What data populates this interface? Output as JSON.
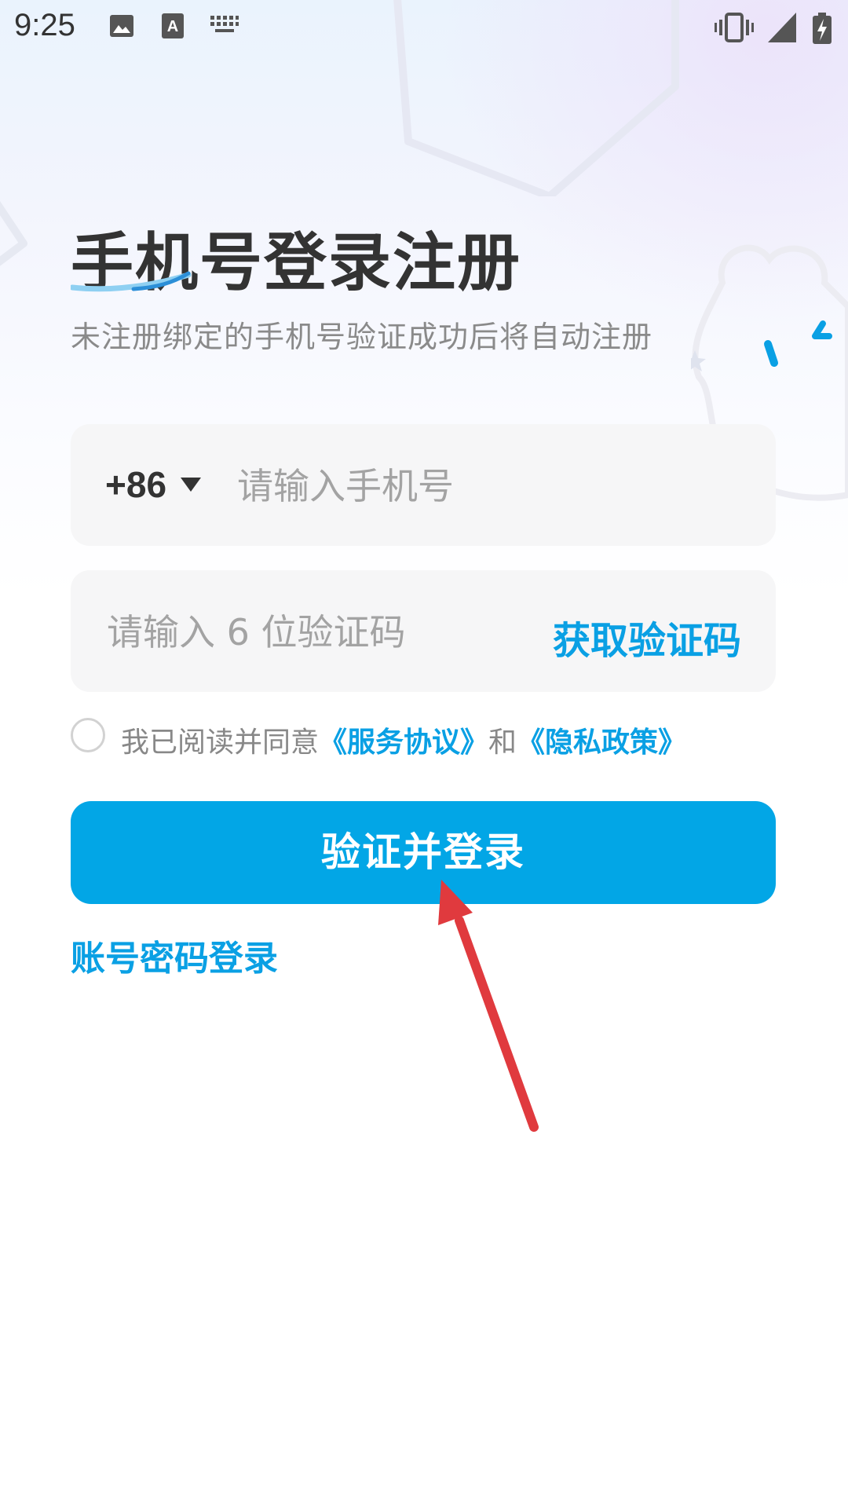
{
  "status_bar": {
    "time": "9:25",
    "icons": [
      "image-icon",
      "text-a-icon",
      "keyboard-icon",
      "vibrate-icon",
      "signal-icon",
      "battery-charging-icon"
    ]
  },
  "header": {
    "title": "手机号登录注册",
    "subtitle": "未注册绑定的手机号验证成功后将自动注册"
  },
  "phone_field": {
    "country_code": "+86",
    "placeholder": "请输入手机号",
    "value": ""
  },
  "code_field": {
    "placeholder": "请输入 6 位验证码",
    "value": "",
    "get_code_label": "获取验证码"
  },
  "agreement": {
    "checked": false,
    "prefix": "我已阅读并同意",
    "service_link": "《服务协议》",
    "conjunction": "和",
    "privacy_link": "《隐私政策》"
  },
  "actions": {
    "submit_label": "验证并登录",
    "alt_login_label": "账号密码登录"
  },
  "colors": {
    "accent": "#02a6e6",
    "link": "#0aa0e4",
    "annotation_arrow": "#e03a3e"
  }
}
